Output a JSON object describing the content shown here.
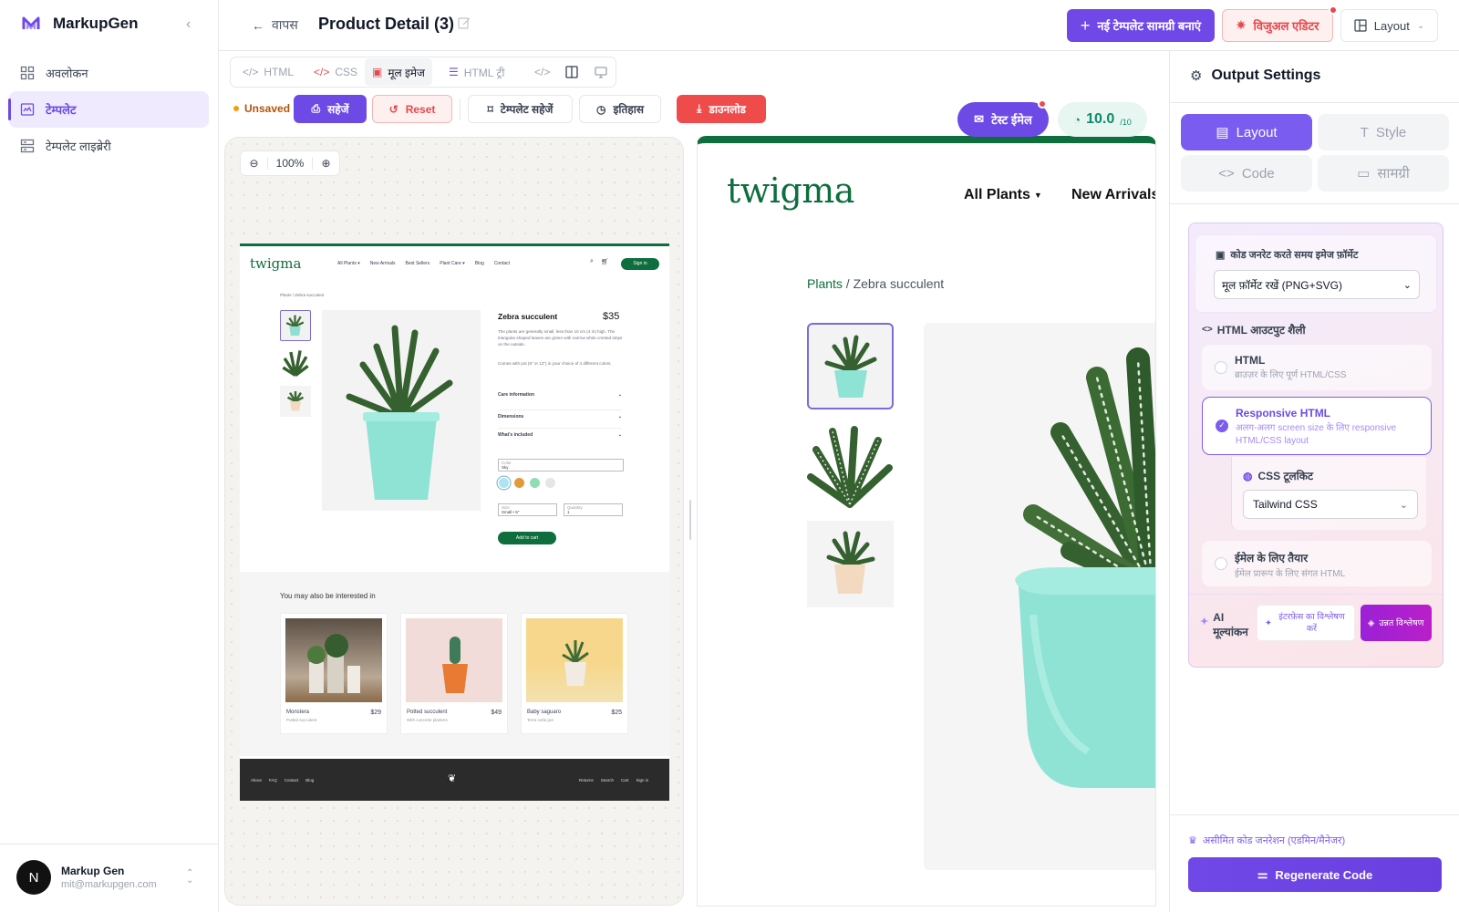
{
  "app": {
    "name": "MarkupGen"
  },
  "sidebar": {
    "items": [
      {
        "label": "अवलोकन"
      },
      {
        "label": "टेम्पलेट"
      },
      {
        "label": "टेम्पलेट लाइब्रेरी"
      }
    ],
    "user": {
      "initial": "N",
      "name": "Markup Gen",
      "email": "mit@markupgen.com"
    }
  },
  "header": {
    "back_label": "वापस",
    "title": "Product Detail (3)",
    "new_template_label": "नई टेम्पलेट सामग्री बनाएं",
    "visual_editor_label": "विजुअल एडिटर",
    "layout_label": "Layout"
  },
  "toolbar": {
    "tabs": [
      "HTML",
      "CSS",
      "मूल इमेज",
      "HTML ट्री"
    ],
    "unsaved_label": "Unsaved",
    "save_label": "सहेजें",
    "reset_label": "Reset",
    "save_template_label": "टेम्पलेट सहेजें",
    "history_label": "इतिहास",
    "download_label": "डाउनलोड",
    "test_email_label": "टेस्ट ईमेल",
    "score": "10.0",
    "score_max": "/10"
  },
  "zoom": {
    "level": "100%"
  },
  "preview_small": {
    "logo": "twigma",
    "nav": [
      "All Plants ▾",
      "New Arrivals",
      "Best Sellers",
      "Plant Care ▾",
      "Blog",
      "Contact"
    ],
    "signin": "Sign in",
    "breadcrumb": "Plants / Zebra succulent",
    "product_name": "Zebra succulent",
    "price": "$35",
    "desc1": "The plants are generally small, less than 10 cm (4 in) high. The triangular shaped leaves are green with narrow white crested strips on the outside.",
    "desc2": "Comes with pot (6\" or 12\") in your choice of 4 different colors.",
    "accordions": [
      "Care information",
      "Dimensions",
      "What's included"
    ],
    "color_label": "Color",
    "color_value": "Sky",
    "size_label": "Size",
    "size_value": "Small • 6\"",
    "qty_label": "Quantity",
    "qty_value": "1",
    "add_to_cart": "Add to cart",
    "related_title": "You may also be interested in",
    "related": [
      {
        "name": "Monstera",
        "price": "$29",
        "sub": "Potted succulent"
      },
      {
        "name": "Potted succulent",
        "price": "$49",
        "sub": "With concrete planters"
      },
      {
        "name": "Baby saguaro",
        "price": "$25",
        "sub": "Terra cotta pot"
      }
    ],
    "footer_left": [
      "About",
      "FAQ",
      "Contact",
      "Blog"
    ],
    "footer_right": [
      "Returns",
      "Search",
      "Cart",
      "Sign in"
    ]
  },
  "preview_large": {
    "logo": "twigma",
    "nav": [
      "All Plants",
      "New Arrivals"
    ],
    "breadcrumb_link": "Plants",
    "breadcrumb_rest": " / Zebra succulent"
  },
  "settings": {
    "title": "Output Settings",
    "tabs": [
      "Layout",
      "Style",
      "Code",
      "सामग्री"
    ],
    "image_format_label": "कोड जनरेट करते समय इमेज फ़ॉर्मेट",
    "image_format_value": "मूल फ़ॉर्मेट रखें (PNG+SVG)",
    "html_style_label": "HTML आउटपुट शैली",
    "options": [
      {
        "title": "HTML",
        "sub": "ब्राउज़र के लिए पूर्ण HTML/CSS"
      },
      {
        "title": "Responsive HTML",
        "sub": "अलग-अलग screen size के लिए responsive HTML/CSS layout"
      },
      {
        "title": "ईमेल के लिए तैयार",
        "sub": "ईमेल प्रारूप के लिए संगत HTML"
      }
    ],
    "css_toolkit_label": "CSS टूलकिट",
    "css_toolkit_value": "Tailwind CSS",
    "ai_label": "AI मूल्यांकन",
    "analyze_label": "इंटरफ़ेस का विश्लेषण करें",
    "advanced_label": "उन्नत विश्लेषण",
    "unlimited_label": "असीमित कोड जनरेशन (एडमिन/मैनेजर)",
    "regenerate_label": "Regenerate Code"
  },
  "colors": {
    "accent": "#6d4ae6",
    "brand_green": "#0e6e3d",
    "danger": "#e5484d"
  }
}
